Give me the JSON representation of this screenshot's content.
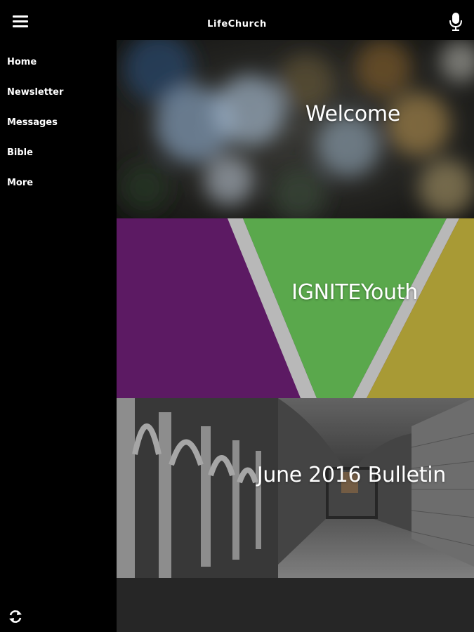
{
  "header": {
    "title": "LifeChurch",
    "menu_icon": "hamburger-menu-icon",
    "mic_icon": "microphone-icon"
  },
  "sidebar": {
    "items": [
      {
        "label": "Home"
      },
      {
        "label": "Newsletter"
      },
      {
        "label": "Messages"
      },
      {
        "label": "Bible"
      },
      {
        "label": "More"
      }
    ],
    "refresh_icon": "refresh-icon"
  },
  "tiles": [
    {
      "label": "Welcome"
    },
    {
      "label": "IGNITEYouth"
    },
    {
      "label": "June 2016 Bulletin"
    }
  ],
  "colors": {
    "background": "#000000",
    "content_bg": "#262626",
    "ignite_purple": "#5c1a63",
    "ignite_green": "#5aa84c",
    "ignite_olive": "#a89a35",
    "ignite_gray": "#b8b8b8"
  }
}
